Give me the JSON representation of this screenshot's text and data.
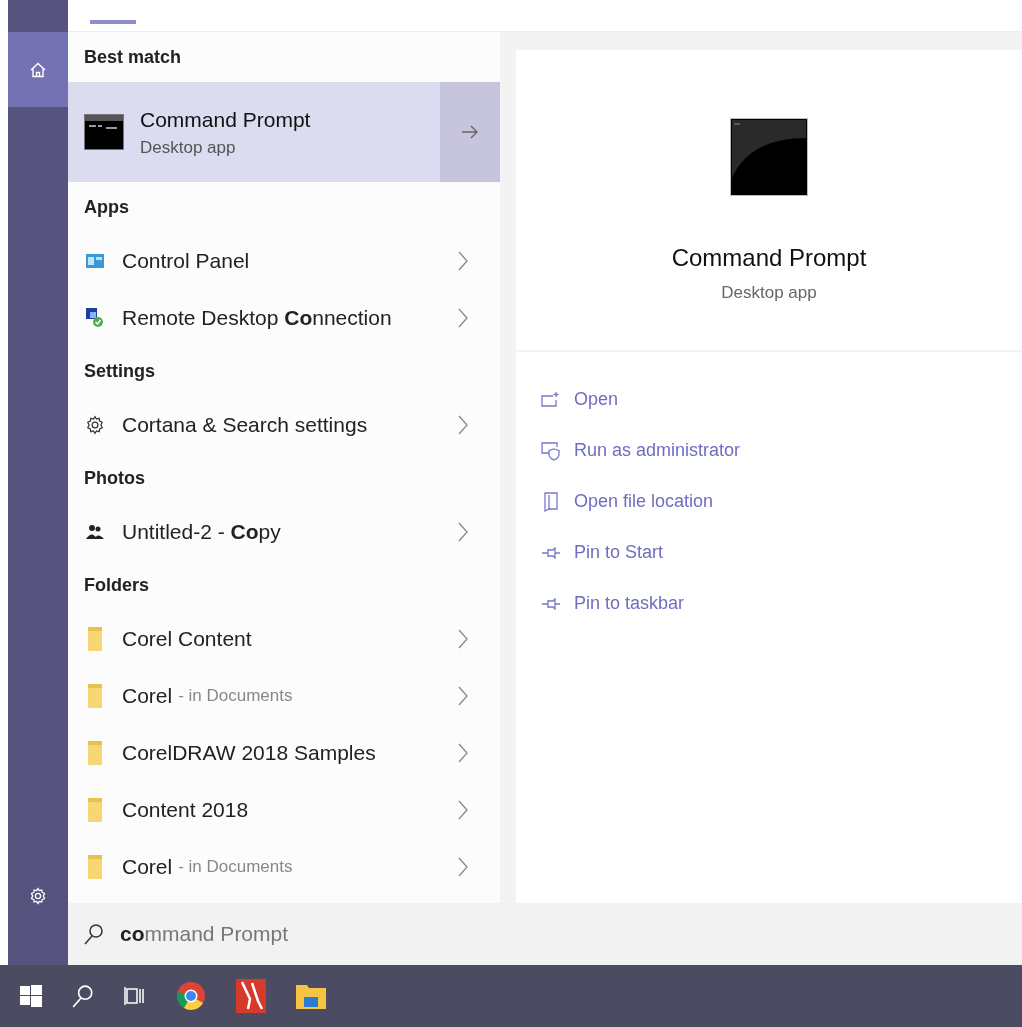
{
  "nav": [
    {
      "kind": "home",
      "selected": true
    },
    {
      "kind": "settings",
      "selected": false
    }
  ],
  "results": [
    {
      "heading": "Best match",
      "items": [
        {
          "kind": "console",
          "title": "Command Prompt",
          "subtitle": "Desktop app",
          "selected": true
        }
      ]
    },
    {
      "heading": "Apps",
      "items": [
        {
          "kind": "panel",
          "title": "Control Panel",
          "selected": false
        },
        {
          "kind": "remote",
          "title": "Remote Desktop **Co**nnection",
          "selected": false
        }
      ]
    },
    {
      "heading": "Settings",
      "items": [
        {
          "kind": "gear",
          "title": "Cortana & Search settings",
          "selected": false
        }
      ]
    },
    {
      "heading": "Photos",
      "items": [
        {
          "kind": "photo",
          "title": "Untitled-2 - **Co**py",
          "selected": false
        }
      ]
    },
    {
      "heading": "Folders",
      "items": [
        {
          "kind": "folder",
          "title": "Corel Content",
          "selected": false
        },
        {
          "kind": "folder",
          "title": "Corel",
          "detail": "- in Documents",
          "selected": false
        },
        {
          "kind": "folder",
          "title": "CorelDRAW 2018 Samples",
          "selected": false
        },
        {
          "kind": "folder",
          "title": "Content 2018",
          "selected": false
        },
        {
          "kind": "folder",
          "title": "Corel",
          "detail": "- in Documents",
          "selected": false
        }
      ]
    }
  ],
  "preview": {
    "title": "Command Prompt",
    "subtitle": "Desktop app",
    "actions": [
      "Open",
      "Run as administrator",
      "Open file location",
      "Pin to Start",
      "Pin to taskbar"
    ]
  },
  "search": {
    "value": "**co**mmand Prompt"
  }
}
